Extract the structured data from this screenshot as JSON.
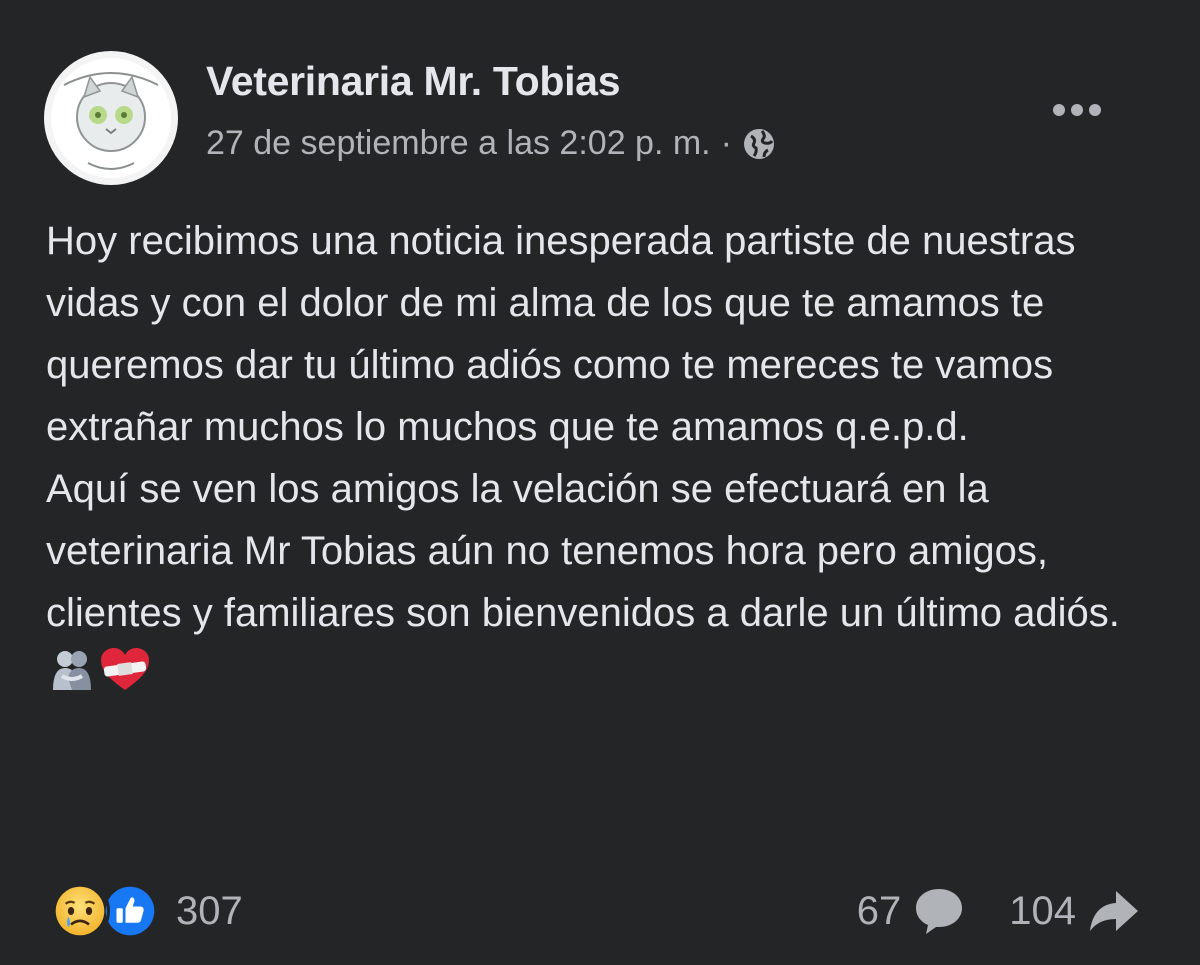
{
  "post": {
    "author": "Veterinaria Mr. Tobias",
    "timestamp": "27 de septiembre a las 2:02 p. m.",
    "separator": "·",
    "audience_icon": "globe-icon",
    "more_icon": "more-horizontal-icon",
    "text": "Hoy recibimos una noticia inesperada partiste de nuestras vidas y con el dolor de mi alma de los que te amamos te queremos dar tu último adiós como te mereces te vamos extrañar muchos lo muchos que te amamos q.e.p.d.\nAquí se ven los amigos la velación se efectuará en la veterinaria Mr Tobias aún no tenemos hora pero amigos, clientes y familiares son bienvenidos a darle un último adiós.",
    "trailing_emojis": [
      "people-hugging-emoji",
      "mending-heart-emoji"
    ]
  },
  "footer": {
    "reactions": [
      "sad-reaction",
      "like-reaction"
    ],
    "reaction_count": "307",
    "comment_count": "67",
    "share_count": "104"
  },
  "colors": {
    "background": "#242526",
    "primary_text": "#e4e6eb",
    "secondary_text": "#b0b3b8",
    "like_blue": "#1877f2",
    "sad_yellow": "#f7c23a"
  }
}
